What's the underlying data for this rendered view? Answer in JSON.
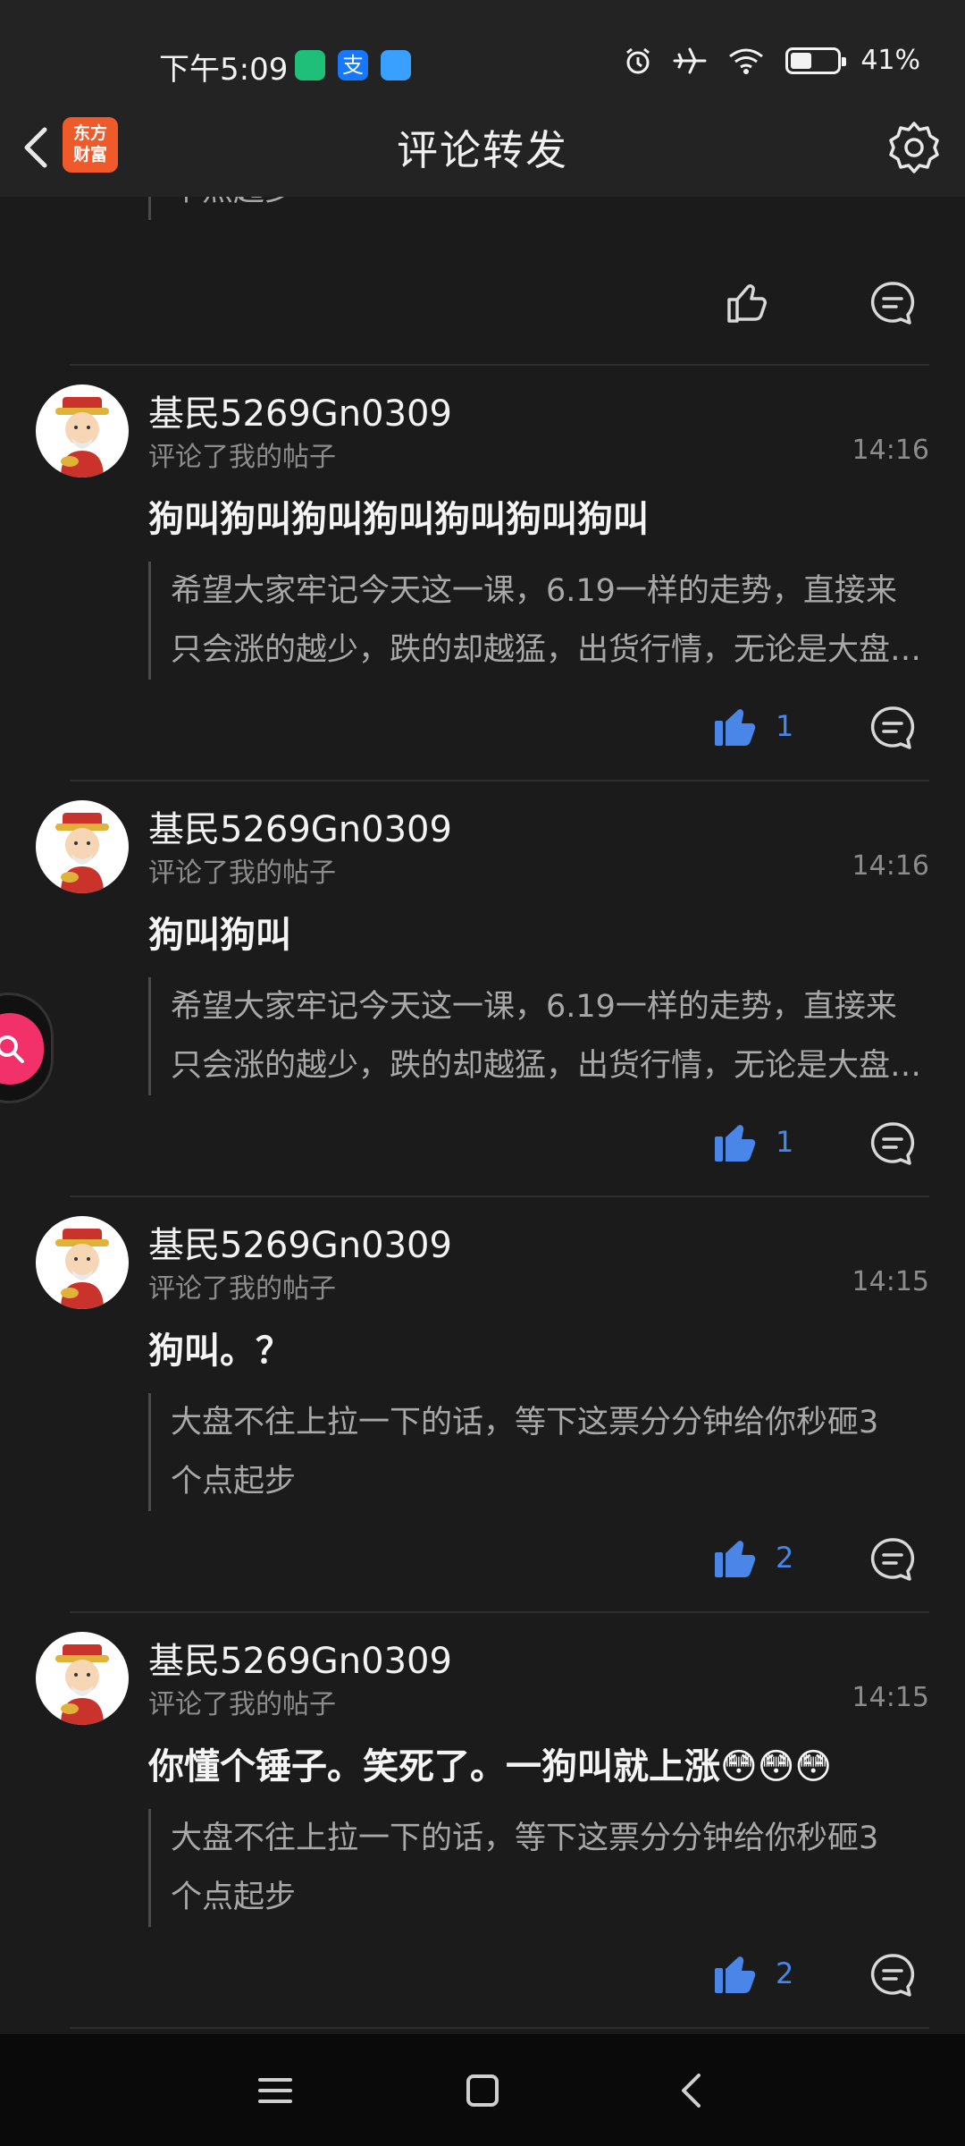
{
  "status_bar": {
    "time": "下午5:09",
    "battery_percent": "41%",
    "battery_level": 0.41,
    "icons": [
      "shield-app-icon",
      "alipay-icon",
      "cloud-app-icon",
      "alarm-icon",
      "airplane-icon",
      "wifi-icon",
      "battery-icon"
    ]
  },
  "header": {
    "title": "评论转发",
    "logo_text_line1": "东方",
    "logo_text_line2": "财富"
  },
  "top_partial": {
    "quote_line": "个点起步"
  },
  "items": [
    {
      "username": "基民5269Gn0309",
      "action": "评论了我的帖子",
      "time": "14:16",
      "comment": "狗叫狗叫狗叫狗叫狗叫狗叫狗叫",
      "quote_lines": [
        "希望大家牢记今天这一课，6.19一样的走势，直接来",
        "只会涨的越少，跌的却越猛，出货行情，无论是大盘还是个股"
      ],
      "likes": "1"
    },
    {
      "username": "基民5269Gn0309",
      "action": "评论了我的帖子",
      "time": "14:16",
      "comment": "狗叫狗叫",
      "quote_lines": [
        "希望大家牢记今天这一课，6.19一样的走势，直接来",
        "只会涨的越少，跌的却越猛，出货行情，无论是大盘还是个股"
      ],
      "likes": "1"
    },
    {
      "username": "基民5269Gn0309",
      "action": "评论了我的帖子",
      "time": "14:15",
      "comment": "狗叫。？",
      "quote_lines": [
        "大盘不往上拉一下的话，等下这票分分钟给你秒砸3",
        "个点起步"
      ],
      "likes": "2"
    },
    {
      "username": "基民5269Gn0309",
      "action": "评论了我的帖子",
      "time": "14:15",
      "comment": "你懂个锤子。笑死了。一狗叫就上涨😳😳😳",
      "quote_lines": [
        "大盘不往上拉一下的话，等下这票分分钟给你秒砸3",
        "个点起步"
      ],
      "likes": "2"
    }
  ],
  "colors": {
    "background": "#1b1b1b",
    "header_bg": "#232323",
    "like_blue": "#4a86e8",
    "logo_orange": "#ef5a2a",
    "float_pink": "#f2316a"
  }
}
